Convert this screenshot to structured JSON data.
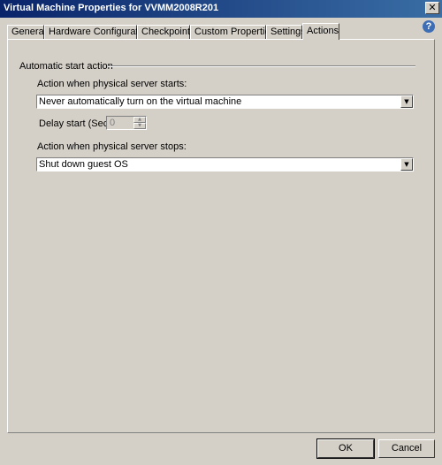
{
  "window": {
    "title": "Virtual Machine Properties for VVMM2008R201",
    "close_glyph": "✕"
  },
  "help": {
    "glyph": "?"
  },
  "tabs": [
    {
      "label": "General"
    },
    {
      "label": "Hardware Configuration"
    },
    {
      "label": "Checkpoints"
    },
    {
      "label": "Custom Properties"
    },
    {
      "label": "Settings"
    },
    {
      "label": "Actions"
    }
  ],
  "group": {
    "title": "Automatic start action"
  },
  "start": {
    "label": "Action when physical server starts:",
    "selected": "Never automatically turn on the virtual machine"
  },
  "delay": {
    "label": "Delay start (Sec):",
    "value": "0"
  },
  "stop": {
    "label": "Action when physical server stops:",
    "selected": "Shut down guest OS"
  },
  "buttons": {
    "ok": "OK",
    "cancel": "Cancel"
  },
  "icons": {
    "dropdown": "chevron-down-icon",
    "spin_up": "spin-up-icon",
    "spin_down": "spin-down-icon"
  }
}
